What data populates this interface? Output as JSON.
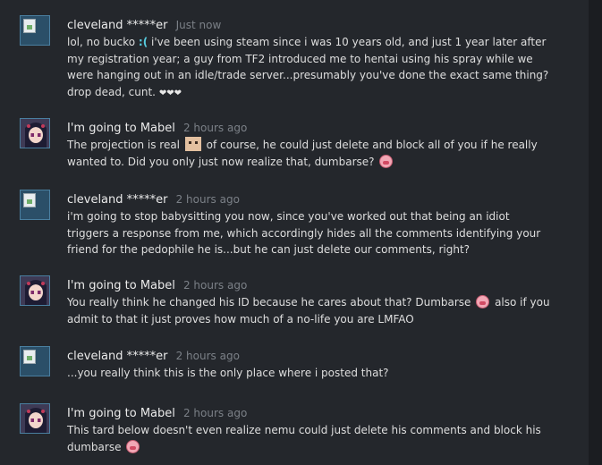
{
  "comments": [
    {
      "author": "cleveland *****er",
      "time": "Just now",
      "avatar": "broken-image",
      "text_a": "lol, no bucko ",
      "emote_a": ":(",
      "text_b": " i've been using steam since i was 10 years old, and just 1 year later after my registration year; a guy from TF2 introduced me to hentai using his spray while we were hanging out in an idle/trade server...presumably you've done the exact same thing? drop dead, cunt. ",
      "tail": "❤❤❤"
    },
    {
      "author": "I'm going to Mabel",
      "time": "2 hours ago",
      "avatar": "anime-girl",
      "text_a": "The projection is real ",
      "text_b": " of course, he could just delete and block all of you if he really wanted to. Did you only just now realize that, dumbarse? "
    },
    {
      "author": "cleveland *****er",
      "time": "2 hours ago",
      "avatar": "broken-image",
      "text_a": "i'm going to stop babysitting you now, since you've worked out that being an idiot triggers a response from me, which accordingly hides all the comments identifying your friend for the pedophile he is...but he can just delete our comments, right?"
    },
    {
      "author": "I'm going to Mabel",
      "time": "2 hours ago",
      "avatar": "anime-girl",
      "text_a": "You really think he changed his ID because he cares about that? Dumbarse ",
      "text_b": " also if you admit to that it just proves how much of a no-life you are LMFAO"
    },
    {
      "author": "cleveland *****er",
      "time": "2 hours ago",
      "avatar": "broken-image",
      "text_a": "...you really think this is the only place where i posted that?"
    },
    {
      "author": "I'm going to Mabel",
      "time": "2 hours ago",
      "avatar": "anime-girl",
      "text_a": "This tard below doesn't even realize nemu could just delete his comments and block his dumbarse "
    }
  ],
  "colors": {
    "background": "#24272c",
    "author": "#ebebeb",
    "timestamp": "#7b8087",
    "text": "#dedede",
    "emote_blue": "#57cbde",
    "heart": "#e8e8e8"
  },
  "icons": [
    "broken-image-icon",
    "anime-avatar",
    "sad-emoticon",
    "face-emoticon",
    "pig-emoticon"
  ]
}
